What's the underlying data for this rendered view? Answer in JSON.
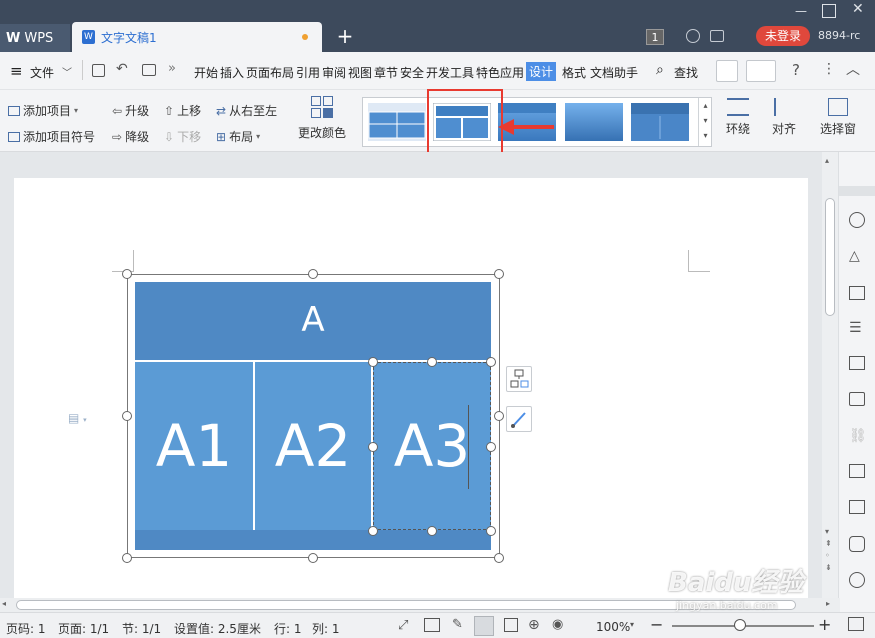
{
  "app": {
    "name": "WPS",
    "doc_tab": "文字文稿1",
    "page_badge": "1",
    "login": "未登录",
    "user_id": "8894-rc"
  },
  "menubar": {
    "file": "文件",
    "items": [
      "开始",
      "插入",
      "页面布局",
      "引用",
      "审阅",
      "视图",
      "章节",
      "安全",
      "开发工具",
      "特色应用"
    ],
    "design": "设计",
    "format": "格式",
    "helper": "文档助手",
    "search": "查找"
  },
  "ribbon": {
    "add_item": "添加项目",
    "add_bullet": "添加项目符号",
    "promote": "升级",
    "demote": "降级",
    "move_up": "上移",
    "move_down": "下移",
    "right_to_left": "从右至左",
    "layout": "布局",
    "change_color": "更改颜色",
    "wrap": "环绕",
    "align": "对齐",
    "select_pane": "选择窗"
  },
  "smartart": {
    "top": "A",
    "c1": "A1",
    "c2": "A2",
    "c3": "A3"
  },
  "status": {
    "page_code": "页码: 1",
    "page": "页面: 1/1",
    "section": "节: 1/1",
    "setting": "设置值: 2.5厘米",
    "row": "行: 1",
    "col": "列: 1",
    "zoom": "100%"
  },
  "watermark": "Baidu经验",
  "watermark_url": "jingyan.baidu.com",
  "colors": {
    "accent": "#4c8ee6",
    "smartart": "#5b9bd5",
    "smartart_top": "#4f89c4",
    "highlight": "#e83a30"
  }
}
